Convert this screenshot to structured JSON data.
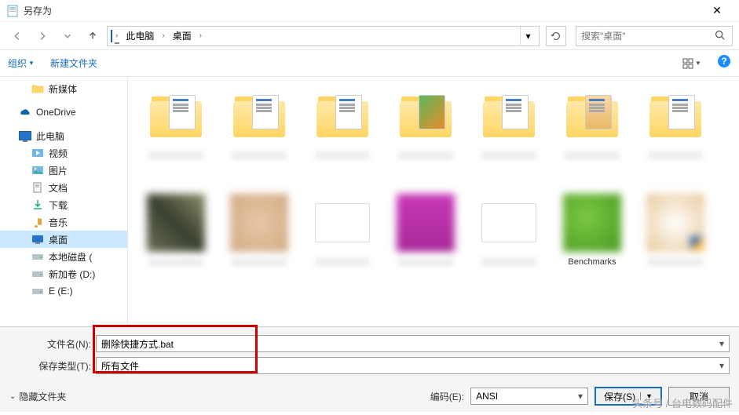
{
  "window": {
    "title": "另存为"
  },
  "nav": {
    "breadcrumb": [
      {
        "label": "此电脑"
      },
      {
        "label": "桌面"
      }
    ],
    "search_placeholder": "搜索\"桌面\""
  },
  "toolbar": {
    "organize": "组织",
    "new_folder": "新建文件夹"
  },
  "tree": {
    "items": [
      {
        "label": "新媒体",
        "icon": "folder",
        "level": 2
      },
      {
        "label": "OneDrive",
        "icon": "onedrive",
        "level": 1
      },
      {
        "label": "此电脑",
        "icon": "pc",
        "level": 1
      },
      {
        "label": "视频",
        "icon": "video",
        "level": 2
      },
      {
        "label": "图片",
        "icon": "pictures",
        "level": 2
      },
      {
        "label": "文档",
        "icon": "docs",
        "level": 2
      },
      {
        "label": "下载",
        "icon": "downloads",
        "level": 2
      },
      {
        "label": "音乐",
        "icon": "music",
        "level": 2
      },
      {
        "label": "桌面",
        "icon": "desktop",
        "level": 2,
        "selected": true
      },
      {
        "label": "本地磁盘 (",
        "icon": "disk",
        "level": 2
      },
      {
        "label": "新加卷 (D:)",
        "icon": "disk",
        "level": 2
      },
      {
        "label": "E (E:)",
        "icon": "disk",
        "level": 2
      }
    ]
  },
  "content": {
    "row1_count": 7,
    "row2_labels": [
      "",
      "",
      "",
      "",
      "",
      "Benchmarks",
      ""
    ]
  },
  "fields": {
    "filename_label": "文件名(N):",
    "filename_value": "删除快捷方式.bat",
    "filetype_label": "保存类型(T):",
    "filetype_value": "所有文件"
  },
  "actions": {
    "hide_files": "隐藏文件夹",
    "encoding_label": "编码(E):",
    "encoding_value": "ANSI",
    "save": "保存(S)",
    "cancel": "取消"
  },
  "watermark": "头条号 / 台电数码配件"
}
